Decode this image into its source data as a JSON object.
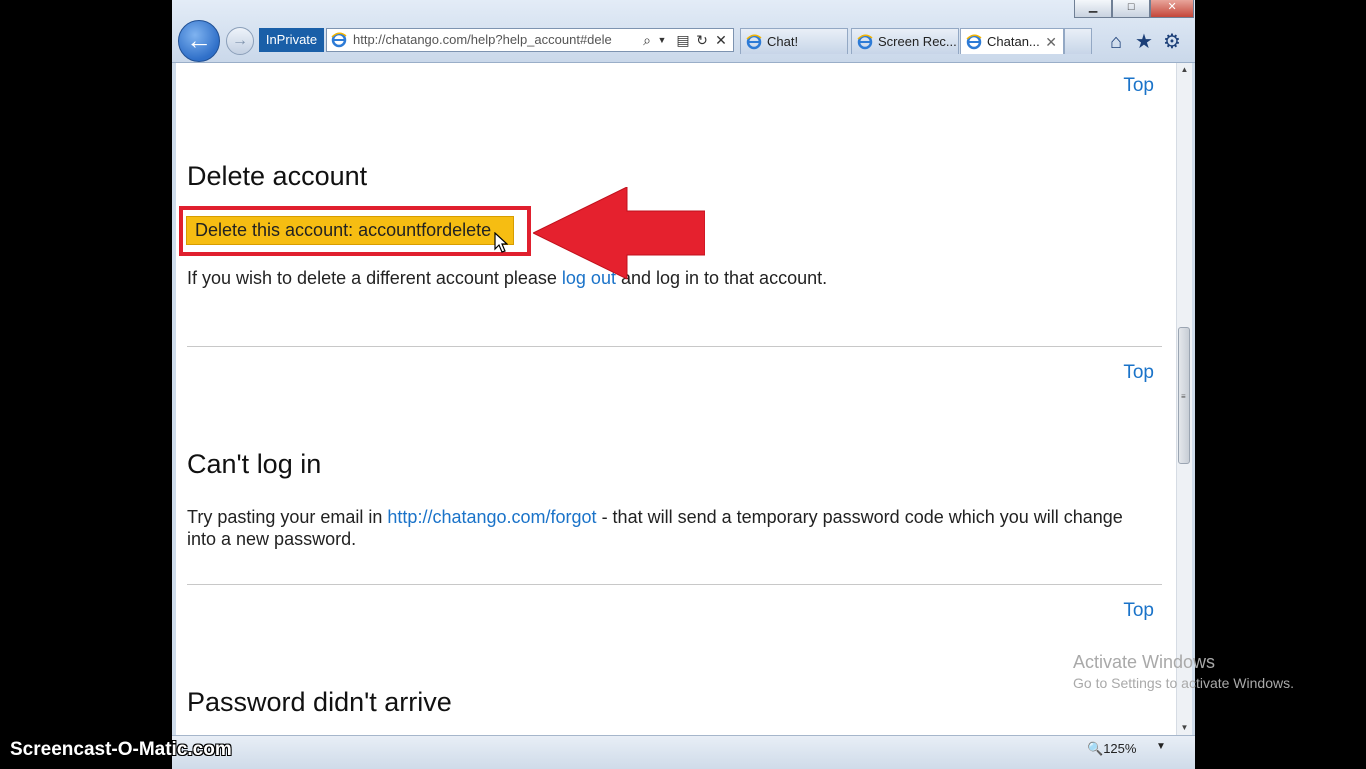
{
  "browser": {
    "inprivate_label": "InPrivate",
    "address_url": "http://chatango.com/help?help_account#dele",
    "tabs": [
      {
        "label": "Chat!",
        "active": false
      },
      {
        "label": "Screen Rec...",
        "active": false
      },
      {
        "label": "Chatan...",
        "active": true
      }
    ],
    "window_controls": {
      "minimize": "▁",
      "maximize": "□",
      "close": "✕"
    },
    "zoom_label": "125%"
  },
  "page": {
    "top_link_label": "Top",
    "sections": [
      {
        "heading": "Delete account",
        "delete_button_label": "Delete this account: accountfordelete",
        "text_before": "If you wish to delete a different account please ",
        "link": "log out",
        "text_after": " and log in to that account."
      },
      {
        "heading": "Can't log in",
        "text_before": "Try pasting your email in ",
        "link": "http://chatango.com/forgot",
        "text_after_line1": " - that will send a temporary password code which you will change",
        "text_after_line2": "into a new password."
      },
      {
        "heading": "Password didn't arrive"
      }
    ]
  },
  "overlay": {
    "watermark_line1": "Activate Windows",
    "watermark_line2": "Go to Settings to activate Windows.",
    "recorder_brand": "Screencast-O-Matic.com"
  },
  "colors": {
    "link": "#1a73c9",
    "button": "#f6bd12",
    "highlight": "#e0202e"
  }
}
